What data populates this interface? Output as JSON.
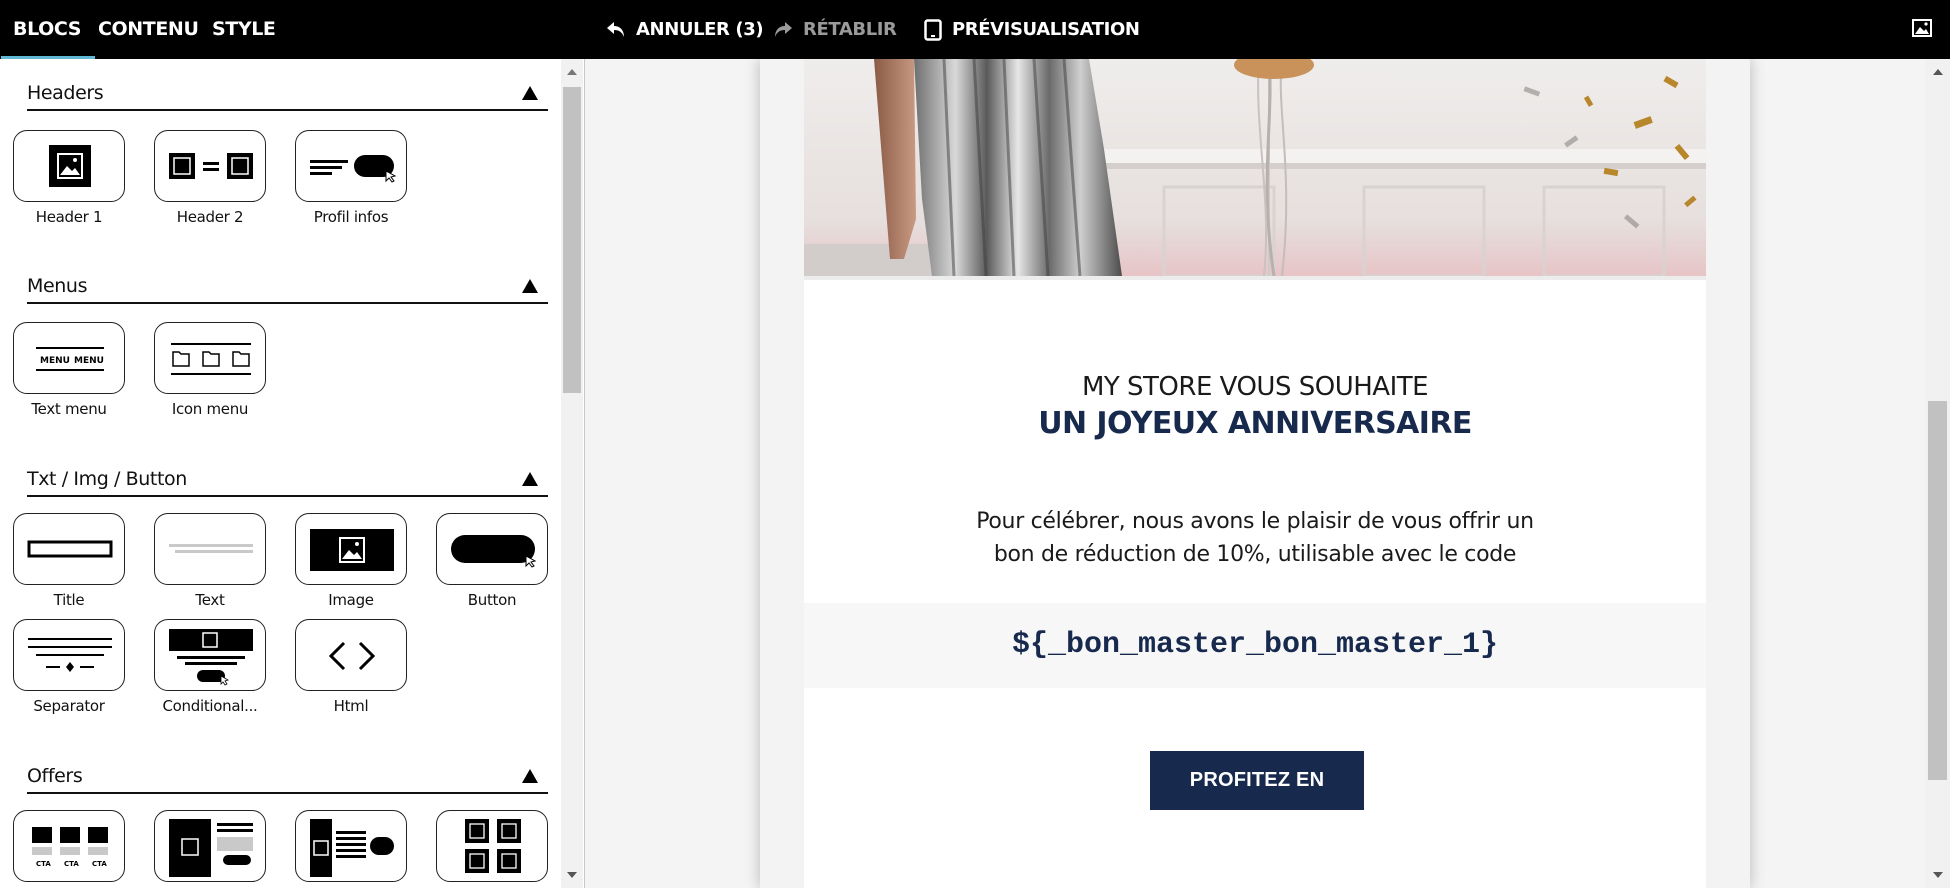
{
  "topbar": {
    "tabs": [
      {
        "label": "BLOCS",
        "active": true
      },
      {
        "label": "CONTENU",
        "active": false
      },
      {
        "label": "STYLE",
        "active": false
      }
    ],
    "undo_label": "ANNULER (3)",
    "redo_label": "RÉTABLIR",
    "preview_label": "PRÉVISUALISATION",
    "icons": {
      "undo": "undo-icon",
      "redo": "redo-icon",
      "preview": "tablet-icon",
      "image": "image-icon"
    }
  },
  "sidebar": {
    "sections": [
      {
        "title": "Headers",
        "blocks": [
          "Header 1",
          "Header 2",
          "Profil infos"
        ]
      },
      {
        "title": "Menus",
        "blocks": [
          "Text menu",
          "Icon menu"
        ]
      },
      {
        "title": "Txt / Img / Button",
        "blocks": [
          "Title",
          "Text",
          "Image",
          "Button",
          "Separator",
          "Conditional...",
          "Html"
        ]
      },
      {
        "title": "Offers",
        "blocks": []
      }
    ]
  },
  "email": {
    "headline_top": "MY STORE VOUS SOUHAITE",
    "headline_main": "UN JOYEUX ANNIVERSAIRE",
    "body_line_1": "Pour célébrer, nous avons le plaisir de vous offrir un",
    "body_line_2": "bon de réduction de 10%, utilisable avec le code",
    "code": "${_bon_master_bon_master_1}",
    "cta_label": "PROFITEZ EN"
  },
  "colors": {
    "topbar_bg": "#000000",
    "active_tab_underline": "#5fb8d4",
    "brand_navy": "#17294d",
    "redo_disabled": "#9a9a9a"
  }
}
